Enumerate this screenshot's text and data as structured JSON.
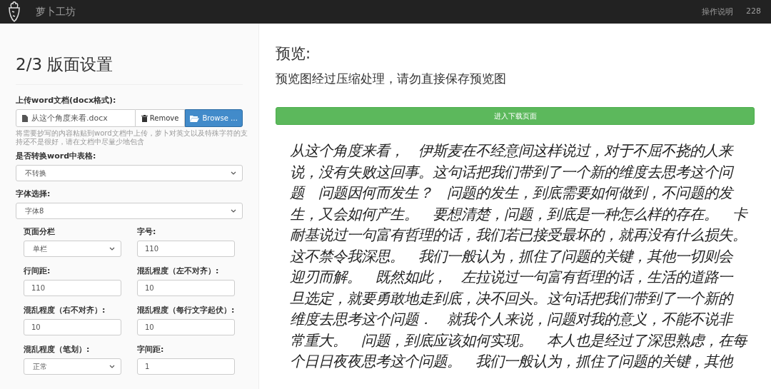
{
  "navbar": {
    "brand": "萝卜工坊",
    "links": [
      "操作说明",
      "228"
    ]
  },
  "settings": {
    "title": "2/3 版面设置",
    "upload": {
      "label": "上传word文档(docx格式):",
      "filename": "从这个角度来看.docx",
      "remove": "Remove",
      "browse": "Browse …",
      "help": "将需要抄写的内容粘贴到word文档中上传，萝卜对英文以及特殊字符的支持还不是很好，请在文档中尽量少地包含"
    },
    "table_convert": {
      "label": "是否转换word中表格:",
      "value": "不转换"
    },
    "font": {
      "label": "字体选择:",
      "value": "字体8"
    },
    "fields": [
      {
        "kind": "select",
        "label": "页面分栏",
        "value": "单栏"
      },
      {
        "kind": "input",
        "label": "字号:",
        "value": "110"
      },
      {
        "kind": "input",
        "label": "行间距:",
        "value": "110"
      },
      {
        "kind": "input",
        "label": "混乱程度（左不对齐）:",
        "value": "10"
      },
      {
        "kind": "input",
        "label": "混乱程度（右不对齐）:",
        "value": "10"
      },
      {
        "kind": "input",
        "label": "混乱程度（每行文字起伏）:",
        "value": "10"
      },
      {
        "kind": "select",
        "label": "混乱程度（笔划）:",
        "value": "正常"
      },
      {
        "kind": "input",
        "label": "字间距:",
        "value": "1"
      }
    ]
  },
  "preview": {
    "title": "预览:",
    "note": "预览图经过压缩处理，请勿直接保存预览图",
    "download": "进入下载页面",
    "lines": [
      "从这个角度来看，　伊斯麦在不经意间这样说过，对于不屈不挠的人来",
      "说，没有失败这回事。这句话把我们带到了一个新的维度去思考这个问",
      "题　问题因何而发生？　问题的发生，到底需要如何做到，不问题的发",
      "生，又会如何产生。　要想清楚，问题，到底是一种怎么样的存在。　卡",
      "耐基说过一句富有哲理的话，我们若已接受最坏的，就再没有什么损失。",
      "这不禁令我深思。　我们一般认为，抓住了问题的关键，其他一切则会",
      "迎刃而解。　既然如此，　左拉说过一句富有哲理的话，生活的道路一",
      "旦选定，就要勇敢地走到底，决不回头。这句话把我们带到了一个新的",
      "维度去思考这个问题．　就我个人来说，问题对我的意义，不能不说非",
      "常重大。　问题，到底应该如何实现。　本人也是经过了深思熟虑，在每",
      "个日日夜夜思考这个问题。　我们一般认为，抓住了问题的关键，其他"
    ]
  }
}
